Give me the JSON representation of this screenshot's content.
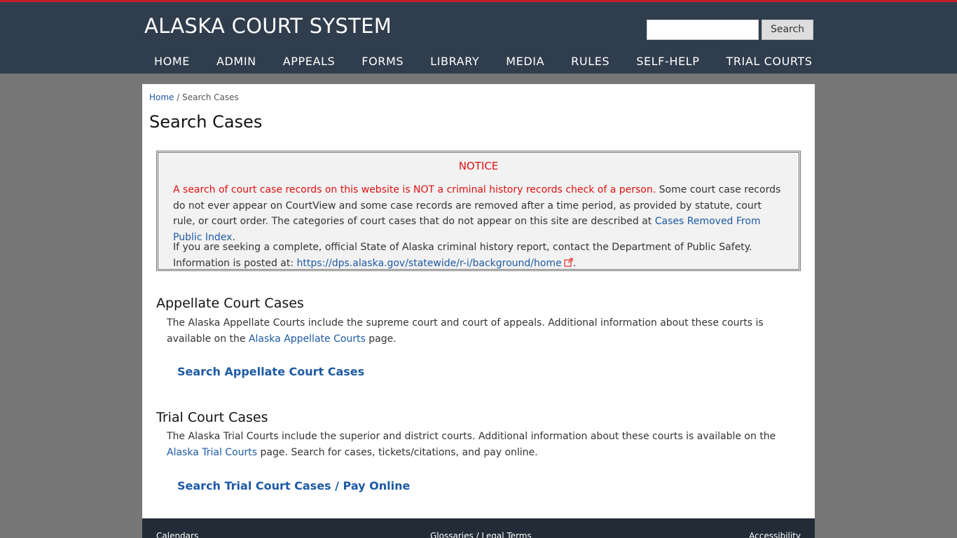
{
  "header": {
    "site_title": "ALASKA COURT SYSTEM",
    "search_placeholder": "",
    "search_button_label": "Search"
  },
  "nav": {
    "items": [
      "HOME",
      "ADMIN",
      "APPEALS",
      "FORMS",
      "LIBRARY",
      "MEDIA",
      "RULES",
      "SELF-HELP",
      "TRIAL COURTS"
    ]
  },
  "breadcrumb": {
    "home": "Home",
    "separator": " / ",
    "current": "Search Cases"
  },
  "page": {
    "title": "Search Cases"
  },
  "notice": {
    "heading": "NOTICE",
    "p1_red": "A search of court case records on this website is NOT a criminal history records check of a person.",
    "p1_text": " Some court case records do not ever appear on CourtView and some case records are removed after a time period, as provided by statute, court rule, or court order. The categories of court cases that do not appear on this site are described at ",
    "p1_link": "Cases Removed From Public Index",
    "p1_end": ".",
    "p2_text": "If you are seeking a complete, official State of Alaska criminal history report, contact the Department of Public Safety. Information is posted at: ",
    "p2_link": "https://dps.alaska.gov/statewide/r-i/background/home",
    "p2_end": "."
  },
  "appellate": {
    "title": "Appellate Court Cases",
    "text": "The Alaska Appellate Courts include the supreme court and court of appeals. Additional information about these courts is available on the ",
    "link": "Alaska Appellate Courts",
    "text_end": " page.",
    "search_link": "Search Appellate Court Cases"
  },
  "trial": {
    "title": "Trial Court Cases",
    "text": "The Alaska Trial Courts include the superior and district courts. Additional information about these courts is available on the ",
    "link": "Alaska Trial Courts",
    "text_end": " page. Search for cases, tickets/citations, and pay online.",
    "search_link": "Search Trial Court Cases / Pay Online"
  },
  "footer": {
    "calendars": "Calendars",
    "glossaries": "Glossaries / Legal Terms",
    "accessibility": "Accessibility"
  },
  "colors": {
    "header_bg": "#303d4d",
    "accent_red": "#dd1111",
    "link_blue": "#1d5aa3",
    "page_bg": "#777777",
    "footer_bg": "#222b36"
  }
}
